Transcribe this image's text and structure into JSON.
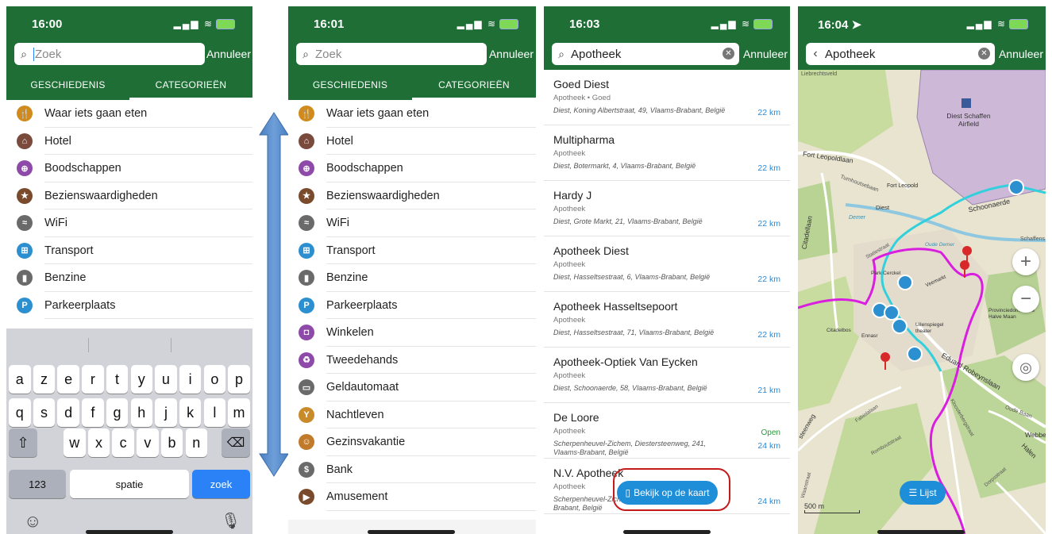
{
  "colors": {
    "brand_green": "#1e6e35",
    "accent_blue": "#1f8ed8",
    "highlight_red": "#c41a1a"
  },
  "screen1": {
    "time": "16:00",
    "search_placeholder": "Zoek",
    "cancel": "Annuleer",
    "tabs": [
      "GESCHIEDENIS",
      "CATEGORIEËN"
    ],
    "categories": [
      {
        "label": "Waar iets gaan eten",
        "icon": "fork-knife-icon",
        "color": "#d08b1c",
        "glyph": "🍴"
      },
      {
        "label": "Hotel",
        "icon": "bed-icon",
        "color": "#7a4a3c",
        "glyph": "⌂"
      },
      {
        "label": "Boodschappen",
        "icon": "cart-icon",
        "color": "#8e4aa8",
        "glyph": "⊕"
      },
      {
        "label": "Bezienswaardigheden",
        "icon": "star-icon",
        "color": "#7a4a2c",
        "glyph": "★"
      },
      {
        "label": "WiFi",
        "icon": "wifi-icon",
        "color": "#6a6a6a",
        "glyph": "≈"
      },
      {
        "label": "Transport",
        "icon": "bus-icon",
        "color": "#2c8fd0",
        "glyph": "⊞"
      },
      {
        "label": "Benzine",
        "icon": "fuel-icon",
        "color": "#6a6a6a",
        "glyph": "▮"
      },
      {
        "label": "Parkeerplaats",
        "icon": "parking-icon",
        "color": "#2c8fd0",
        "glyph": "P"
      }
    ],
    "keyboard": {
      "row1": [
        "a",
        "z",
        "e",
        "r",
        "t",
        "y",
        "u",
        "i",
        "o",
        "p"
      ],
      "row2": [
        "q",
        "s",
        "d",
        "f",
        "g",
        "h",
        "j",
        "k",
        "l",
        "m"
      ],
      "row3": [
        "w",
        "x",
        "c",
        "v",
        "b",
        "n"
      ],
      "numbers": "123",
      "space": "spatie",
      "search": "zoek"
    }
  },
  "screen2": {
    "time": "16:01",
    "search_placeholder": "Zoek",
    "cancel": "Annuleer",
    "tabs": [
      "GESCHIEDENIS",
      "CATEGORIEËN"
    ],
    "categories": [
      {
        "label": "Waar iets gaan eten",
        "icon": "fork-knife-icon",
        "color": "#d08b1c",
        "glyph": "🍴"
      },
      {
        "label": "Hotel",
        "icon": "bed-icon",
        "color": "#7a4a3c",
        "glyph": "⌂"
      },
      {
        "label": "Boodschappen",
        "icon": "cart-icon",
        "color": "#8e4aa8",
        "glyph": "⊕"
      },
      {
        "label": "Bezienswaardigheden",
        "icon": "star-icon",
        "color": "#7a4a2c",
        "glyph": "★"
      },
      {
        "label": "WiFi",
        "icon": "wifi-icon",
        "color": "#6a6a6a",
        "glyph": "≈"
      },
      {
        "label": "Transport",
        "icon": "bus-icon",
        "color": "#2c8fd0",
        "glyph": "⊞"
      },
      {
        "label": "Benzine",
        "icon": "fuel-icon",
        "color": "#6a6a6a",
        "glyph": "▮"
      },
      {
        "label": "Parkeerplaats",
        "icon": "parking-icon",
        "color": "#2c8fd0",
        "glyph": "P"
      },
      {
        "label": "Winkelen",
        "icon": "shopping-bag-icon",
        "color": "#8e4aa8",
        "glyph": "◘"
      },
      {
        "label": "Tweedehands",
        "icon": "secondhand-icon",
        "color": "#8e4aa8",
        "glyph": "♻"
      },
      {
        "label": "Geldautomaat",
        "icon": "atm-icon",
        "color": "#6a6a6a",
        "glyph": "▭"
      },
      {
        "label": "Nachtleven",
        "icon": "cocktail-icon",
        "color": "#c98a2a",
        "glyph": "Y"
      },
      {
        "label": "Gezinsvakantie",
        "icon": "family-icon",
        "color": "#c07a2a",
        "glyph": "☺"
      },
      {
        "label": "Bank",
        "icon": "bank-icon",
        "color": "#6a6a6a",
        "glyph": "$"
      },
      {
        "label": "Amusement",
        "icon": "film-icon",
        "color": "#7a4a2c",
        "glyph": "▶"
      }
    ]
  },
  "screen3": {
    "time": "16:03",
    "search_value": "Apotheek",
    "cancel": "Annuleer",
    "results": [
      {
        "name": "Goed Diest",
        "type": "Apotheek • Goed",
        "address": "Diest, Koning Albertstraat, 49, Vlaams-Brabant, België",
        "distance": "22 km",
        "status": ""
      },
      {
        "name": "Multipharma",
        "type": "Apotheek",
        "address": "Diest, Botermarkt, 4, Vlaams-Brabant, België",
        "distance": "22 km",
        "status": ""
      },
      {
        "name": "Hardy J",
        "type": "Apotheek",
        "address": "Diest, Grote Markt, 21, Vlaams-Brabant, België",
        "distance": "22 km",
        "status": ""
      },
      {
        "name": "Apotheek Diest",
        "type": "Apotheek",
        "address": "Diest, Hasseltsestraat, 6, Vlaams-Brabant, België",
        "distance": "22 km",
        "status": ""
      },
      {
        "name": "Apotheek Hasseltsepoort",
        "type": "Apotheek",
        "address": "Diest, Hasseltsestraat, 71, Vlaams-Brabant, België",
        "distance": "22 km",
        "status": ""
      },
      {
        "name": "Apotheek-Optiek Van Eycken",
        "type": "Apotheek",
        "address": "Diest, Schoonaerde, 58, Vlaams-Brabant, België",
        "distance": "21 km",
        "status": ""
      },
      {
        "name": "De Loore",
        "type": "Apotheek",
        "address": "Scherpenheuvel-Zichem, Diestersteenweg, 241, Vlaams-Brabant, België",
        "distance": "24 km",
        "status": "Open"
      },
      {
        "name": "N.V. Apotheek",
        "type": "Apotheek",
        "address": "Scherpenheuvel-Zichem, Dorpsstraat, 76, Vlaams-Brabant, België",
        "distance": "24 km",
        "status": ""
      }
    ],
    "map_button": "Bekijk op de kaart"
  },
  "screen4": {
    "time": "16:04",
    "search_value": "Apotheek",
    "cancel": "Annuleer",
    "map_labels": {
      "airfield": "Diest Schaffen Airfield",
      "fort": "Fort Leopold",
      "fort_leopoldlaan": "Fort Leopoldlaan",
      "citadellaan": "Citadellaan",
      "schoonaerde": "Schoonaerde",
      "diest": "Diest",
      "park": "Park Cerckel",
      "veemarkt": "Veemarkt",
      "uilenspiegel": "Uilenspiegel theater",
      "provincie": "Provinciedomein De Halve Maan",
      "citadelbos": "Citadelbos",
      "ennasr": "Ennasr",
      "robeyns": "Eduard Robeynslaan",
      "kloosterbergstraat": "Kloosterbergstraat",
      "fabiolalaan": "Fabiolalaan",
      "romboutstraat": "Romboutstraat",
      "oude_baan": "Oude Baan",
      "halen": "Halen",
      "webbe": "Webbe",
      "turnhoutsebaan": "Turnhoutsebaan",
      "liebrechtsveld": "Liebrechtsveld",
      "statie": "Statiestraat",
      "dorpsstraat": "Dorpsstraat",
      "schaffens": "Schaffens",
      "demer": "Demer",
      "oude_demer": "Oude Demer",
      "steenweg": "steenweg",
      "waanstraat": "Waanstraat"
    },
    "scale": "500 m",
    "list_button": "Lijst"
  }
}
